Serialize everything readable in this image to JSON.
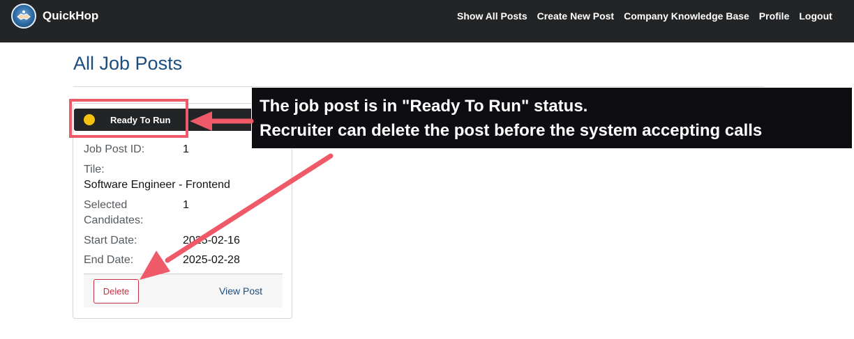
{
  "app": {
    "name": "QuickHop"
  },
  "nav": {
    "items": [
      "Show All Posts",
      "Create New Post",
      "Company Knowledge Base",
      "Profile",
      "Logout"
    ]
  },
  "page": {
    "title": "All Job Posts"
  },
  "card": {
    "status": "Ready To Run",
    "status_color": "#f5c00e",
    "job_post_id_label": "Job Post ID:",
    "job_post_id": "1",
    "title_label": "Tile:",
    "title": "Software Engineer - Frontend",
    "selected_label_line1": "Selected",
    "selected_label_line2": "Candidates:",
    "selected_count": "1",
    "start_label": "Start Date:",
    "start_date": "2025-02-16",
    "end_label": "End Date:",
    "end_date": "2025-02-28",
    "delete_label": "Delete",
    "view_label": "View Post"
  },
  "annotation": {
    "line1": "The job post is in \"Ready To Run\" status.",
    "line2": "Recruiter can delete the post before the system accepting calls",
    "highlight_color": "#ef5a68"
  }
}
